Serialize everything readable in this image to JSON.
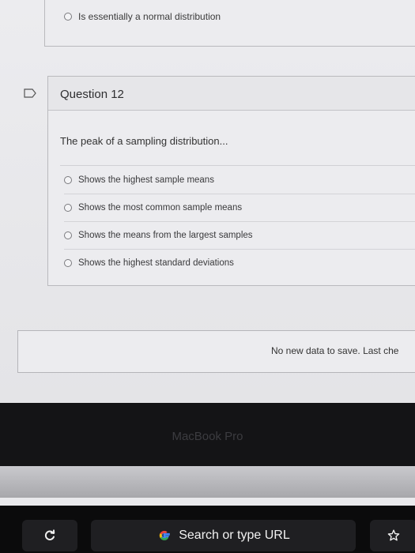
{
  "previous_question": {
    "option_text": "Is essentially a normal distribution"
  },
  "question": {
    "title": "Question 12",
    "prompt": "The peak of a sampling distribution...",
    "options": [
      "Shows the highest sample means",
      "Shows the most common sample means",
      "Shows the means from the largest samples",
      "Shows the highest standard deviations"
    ]
  },
  "save_bar": {
    "status_text": "No new data to save. Last che"
  },
  "laptop": {
    "brand_text": "MacBook Pro"
  },
  "touch_bar": {
    "url_text": "Search or type URL"
  },
  "icons": {
    "flag": "flag-icon",
    "reload": "reload-icon",
    "search_engine": "google-icon",
    "bookmark": "star-icon"
  }
}
